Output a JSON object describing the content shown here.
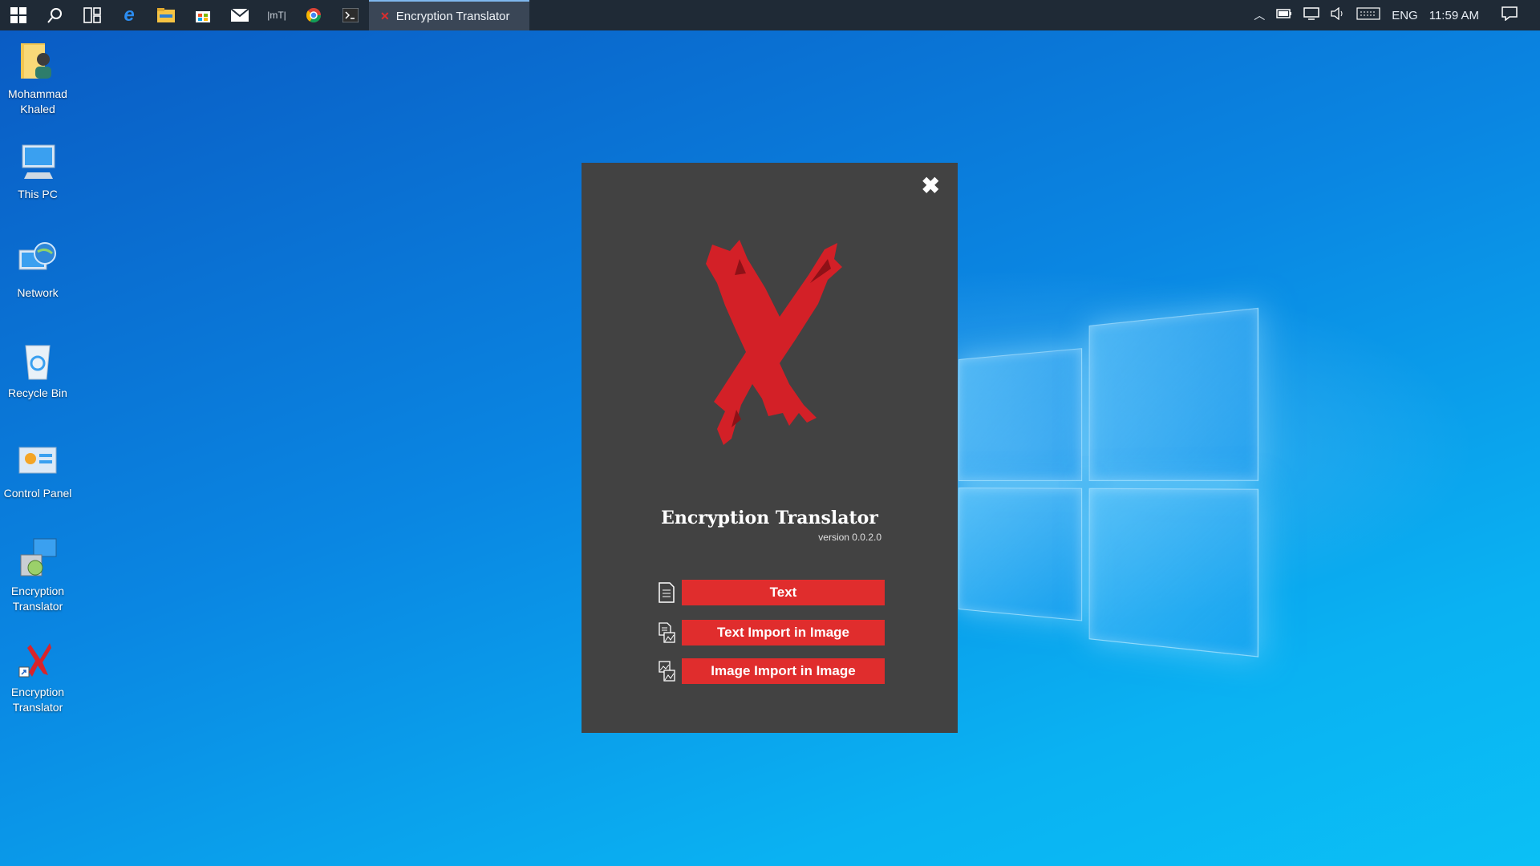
{
  "taskbar": {
    "icons": [
      "windows-start-icon",
      "search-icon",
      "task-view-icon",
      "edge-icon",
      "file-explorer-icon",
      "store-icon",
      "mail-icon",
      "mt-icon",
      "chrome-icon",
      "terminal-icon"
    ],
    "mt_label": "|mT|",
    "active_app": "Encryption Translator",
    "tray": {
      "language": "ENG",
      "time": "11:59 AM"
    }
  },
  "desktop": {
    "icons": [
      {
        "label": "Mohammad Khaled"
      },
      {
        "label": "This PC"
      },
      {
        "label": "Network"
      },
      {
        "label": "Recycle Bin"
      },
      {
        "label": "Control Panel"
      },
      {
        "label": "Encryption Translator"
      },
      {
        "label": "Encryption Translator"
      }
    ]
  },
  "dialog": {
    "close_glyph": "✖",
    "title": "Encryption Translator",
    "version": "version 0.0.2.0",
    "buttons": [
      {
        "label": "Text"
      },
      {
        "label": "Text Import in Image"
      },
      {
        "label": "Image Import in Image"
      }
    ]
  },
  "colors": {
    "accent_red": "#e02d2d",
    "dialog_bg": "#424242",
    "taskbar_bg": "#1f2a36"
  }
}
